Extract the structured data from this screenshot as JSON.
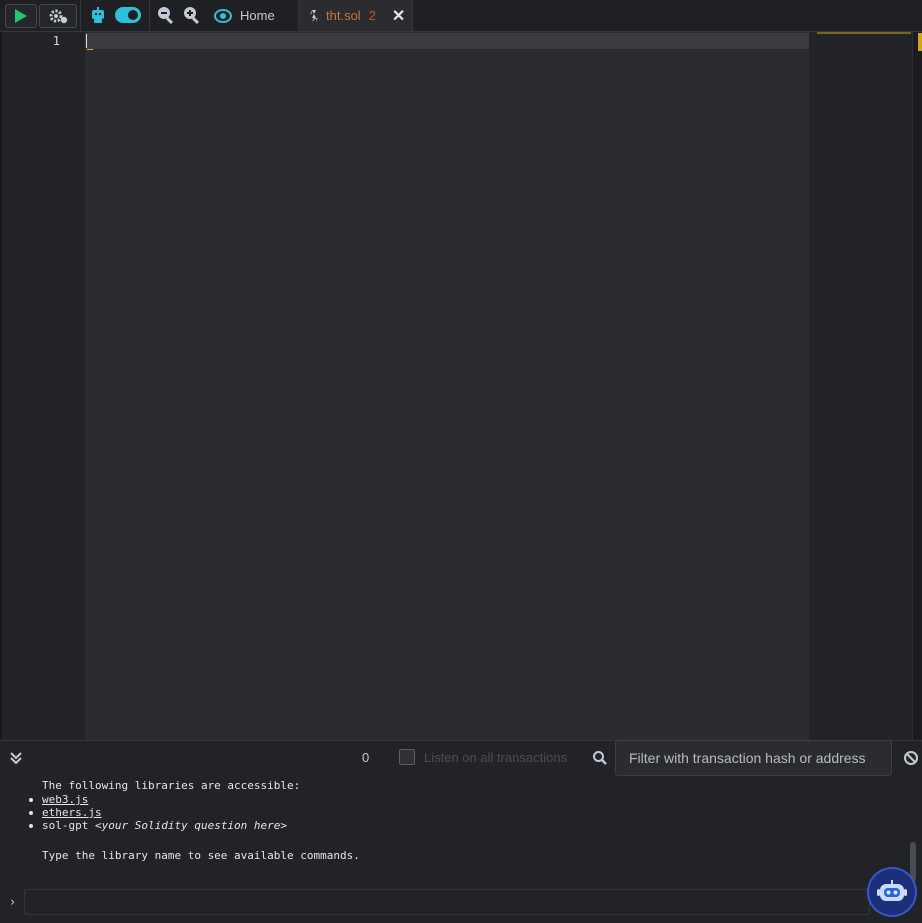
{
  "toolbar": {
    "run_icon": "play-icon",
    "settings_icon": "gear-icon",
    "ai_icon": "robot-icon",
    "ai_toggle_on": true,
    "zoom_out_icon": "zoom-out-icon",
    "zoom_in_icon": "zoom-in-icon"
  },
  "tabs": [
    {
      "icon": "remix-logo-icon",
      "label": "Home"
    },
    {
      "icon": "solidity-icon",
      "label": "tht.sol",
      "problem_count": "2",
      "close_icon": "close-icon"
    }
  ],
  "editor": {
    "line_numbers": [
      "1"
    ],
    "code": ""
  },
  "terminal": {
    "pending_count": "0",
    "listen_label": "Listen on all transactions",
    "filter_placeholder": "Filter with transaction hash or address",
    "intro": "The following libraries are accessible:",
    "libraries": [
      {
        "name": "web3.js",
        "link": true
      },
      {
        "name": "ethers.js",
        "link": true
      }
    ],
    "gpt_cmd": "sol-gpt",
    "gpt_hint": "<your Solidity question here>",
    "footer": "Type the library name to see available commands.",
    "prompt": "›"
  },
  "colors": {
    "accent": "#2fbfd8",
    "run_green": "#2cbf6c",
    "file_tab": "#c1793c",
    "warning": "#d7a21c"
  }
}
